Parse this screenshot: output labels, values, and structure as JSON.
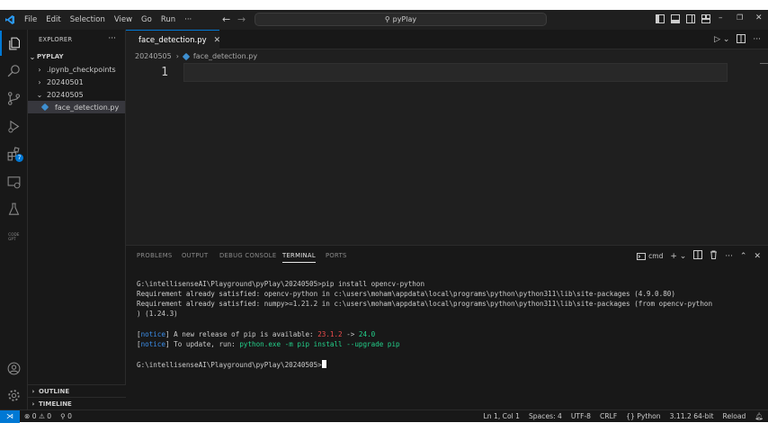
{
  "menu": [
    "File",
    "Edit",
    "Selection",
    "View",
    "Go",
    "Run",
    "···"
  ],
  "command_center": {
    "text": "pyPlay"
  },
  "sidebar": {
    "title": "EXPLORER",
    "project": "PYPLAY",
    "items": [
      {
        "label": ".ipynb_checkpoints",
        "type": "folder",
        "expanded": false
      },
      {
        "label": "20240501",
        "type": "folder",
        "expanded": false
      },
      {
        "label": "20240505",
        "type": "folder",
        "expanded": true
      },
      {
        "label": "face_detection.py",
        "type": "file",
        "selected": true
      }
    ],
    "outline": "OUTLINE",
    "timeline": "TIMELINE"
  },
  "extensions_badge": "7",
  "editor": {
    "tab_label": "face_detection.py",
    "breadcrumb": [
      "20240505",
      "face_detection.py"
    ],
    "line_number": "1"
  },
  "panel": {
    "tabs": [
      "PROBLEMS",
      "OUTPUT",
      "DEBUG CONSOLE",
      "TERMINAL",
      "PORTS"
    ],
    "active_tab": "TERMINAL",
    "shell": "cmd",
    "terminal": {
      "line1": "G:\\intellisenseAI\\Playground\\pyPlay\\20240505>pip install opencv-python",
      "line2": "Requirement already satisfied: opencv-python in c:\\users\\moham\\appdata\\local\\programs\\python\\python311\\lib\\site-packages (4.9.0.80)",
      "line3": "Requirement already satisfied: numpy>=1.21.2 in c:\\users\\moham\\appdata\\local\\programs\\python\\python311\\lib\\site-packages (from opencv-python",
      "line4": ") (1.24.3)",
      "notice_tag": "notice",
      "notice1_text": " A new release of pip is available: ",
      "notice1_old": "23.1.2",
      "notice1_arrow": " -> ",
      "notice1_new": "24.0",
      "notice2_text": " To update, run: ",
      "notice2_cmd": "python.exe -m pip install --upgrade pip",
      "prompt": "G:\\intellisenseAI\\Playground\\pyPlay\\20240505>"
    }
  },
  "statusbar": {
    "errors": "0",
    "warnings": "0",
    "ports": "0",
    "position": "Ln 1, Col 1",
    "spaces": "Spaces: 4",
    "encoding": "UTF-8",
    "eol": "CRLF",
    "language": "Python",
    "interpreter": "3.11.2 64-bit",
    "reload": "Reload"
  },
  "colors": {
    "accent": "#0078d4",
    "python_icon": "#3e8fd0",
    "term_blue": "#3b8eea",
    "term_red": "#f14c4c",
    "term_green": "#23d18b"
  }
}
